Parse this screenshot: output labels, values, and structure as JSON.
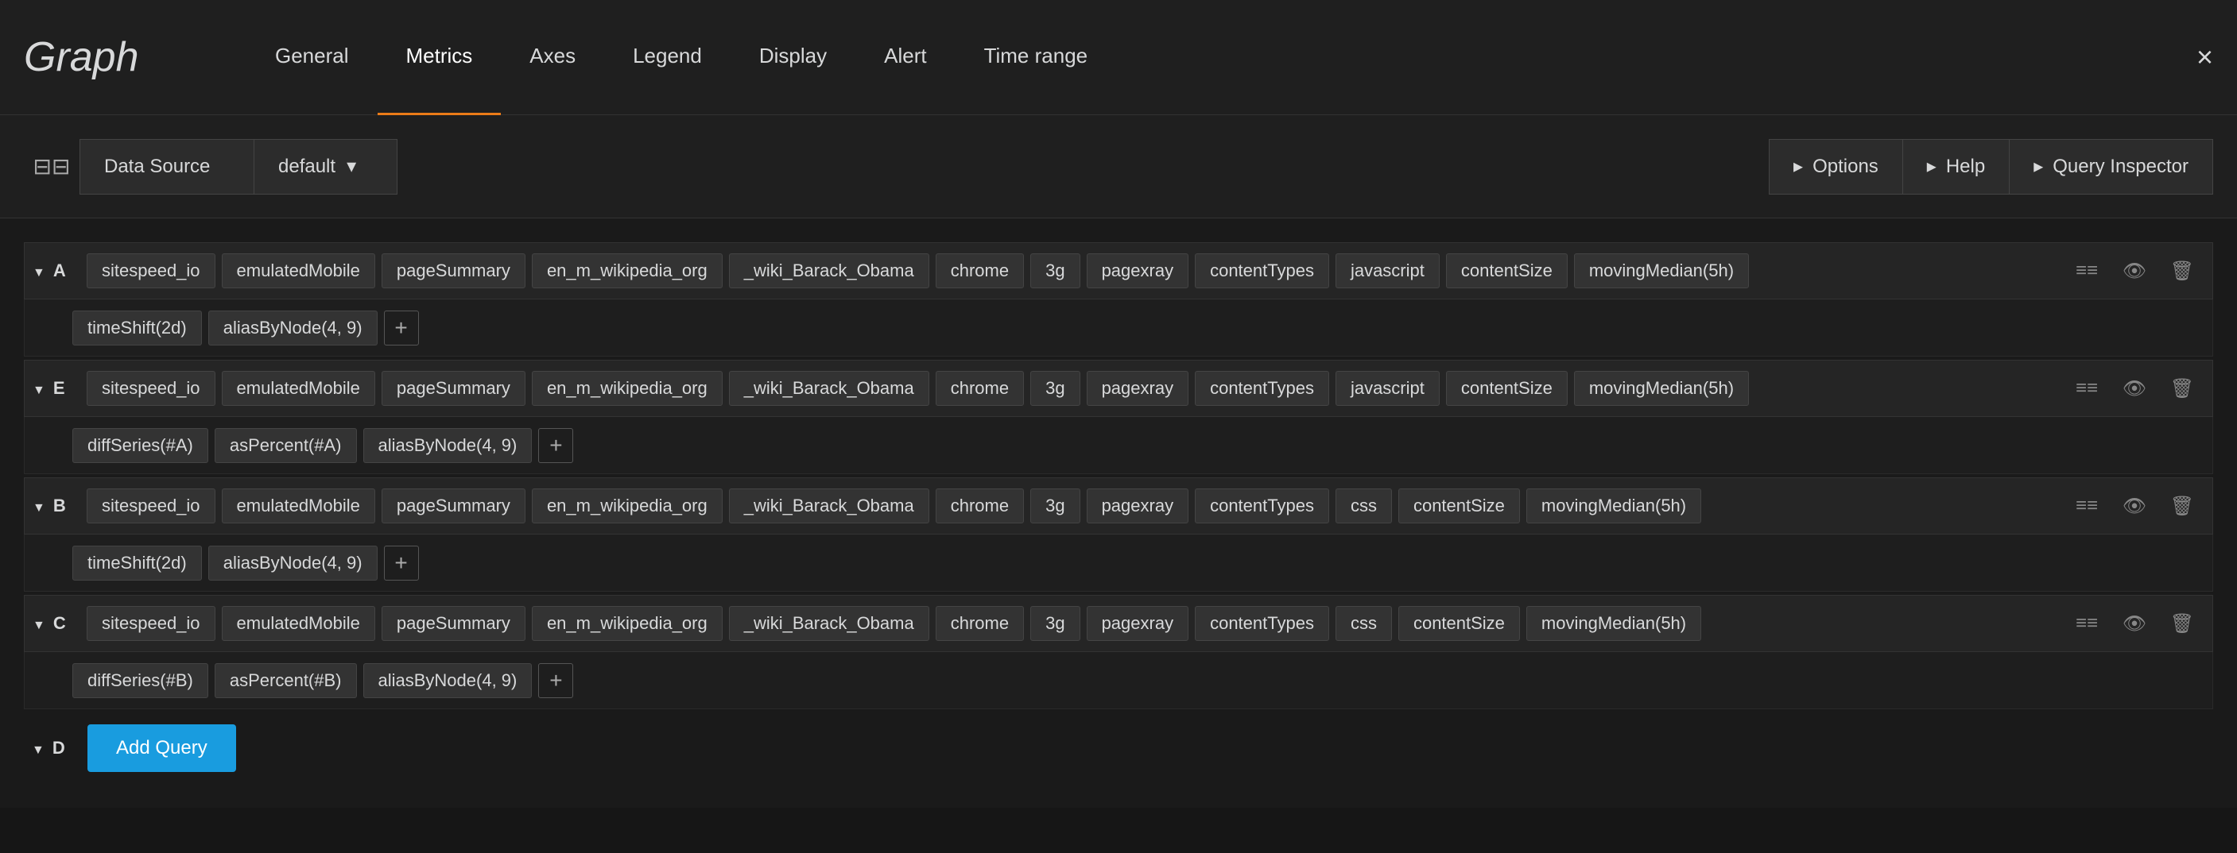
{
  "header": {
    "title": "Graph",
    "close_label": "×",
    "tabs": [
      {
        "label": "General",
        "active": false
      },
      {
        "label": "Metrics",
        "active": true
      },
      {
        "label": "Axes",
        "active": false
      },
      {
        "label": "Legend",
        "active": false
      },
      {
        "label": "Display",
        "active": false
      },
      {
        "label": "Alert",
        "active": false
      },
      {
        "label": "Time range",
        "active": false
      }
    ]
  },
  "toolbar": {
    "datasource_label": "Data Source",
    "datasource_value": "default",
    "options_label": "Options",
    "help_label": "Help",
    "query_inspector_label": "Query Inspector"
  },
  "queries": [
    {
      "id": "A",
      "tags": [
        "sitespeed_io",
        "emulatedMobile",
        "pageSummary",
        "en_m_wikipedia_org",
        "_wiki_Barack_Obama",
        "chrome",
        "3g",
        "pagexray",
        "contentTypes",
        "javascript",
        "contentSize",
        "movingMedian(5h)"
      ],
      "sub_tags": [
        "timeShift(2d)",
        "aliasByNode(4, 9)"
      ]
    },
    {
      "id": "E",
      "tags": [
        "sitespeed_io",
        "emulatedMobile",
        "pageSummary",
        "en_m_wikipedia_org",
        "_wiki_Barack_Obama",
        "chrome",
        "3g",
        "pagexray",
        "contentTypes",
        "javascript",
        "contentSize",
        "movingMedian(5h)"
      ],
      "sub_tags": [
        "diffSeries(#A)",
        "asPercent(#A)",
        "aliasByNode(4, 9)"
      ]
    },
    {
      "id": "B",
      "tags": [
        "sitespeed_io",
        "emulatedMobile",
        "pageSummary",
        "en_m_wikipedia_org",
        "_wiki_Barack_Obama",
        "chrome",
        "3g",
        "pagexray",
        "contentTypes",
        "css",
        "contentSize",
        "movingMedian(5h)"
      ],
      "sub_tags": [
        "timeShift(2d)",
        "aliasByNode(4, 9)"
      ]
    },
    {
      "id": "C",
      "tags": [
        "sitespeed_io",
        "emulatedMobile",
        "pageSummary",
        "en_m_wikipedia_org",
        "_wiki_Barack_Obama",
        "chrome",
        "3g",
        "pagexray",
        "contentTypes",
        "css",
        "contentSize",
        "movingMedian(5h)"
      ],
      "sub_tags": [
        "diffSeries(#B)",
        "asPercent(#B)",
        "aliasByNode(4, 9)"
      ]
    },
    {
      "id": "D",
      "tags": [],
      "sub_tags": [],
      "add_query": true
    }
  ],
  "add_query_label": "Add Query"
}
